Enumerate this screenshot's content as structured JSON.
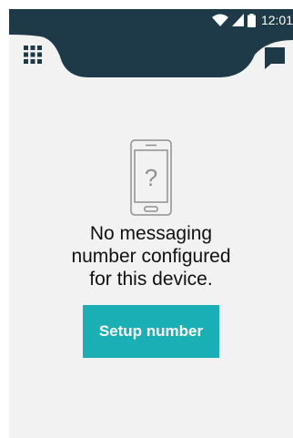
{
  "status_bar": {
    "time": "12:01",
    "icons": [
      "wifi-icon",
      "cellular-signal-icon",
      "battery-icon"
    ]
  },
  "app_bar": {
    "left_icon": "apps-grid-icon",
    "right_icon": "chat-bubble-icon"
  },
  "empty_state": {
    "illustration": "phone-question-icon",
    "message": "No messaging number configured for this device.",
    "button_label": "Setup number"
  },
  "colors": {
    "app_bar": "#1e3a48",
    "background": "#f2f2f2",
    "accent": "#1aafb4",
    "text": "#111111"
  }
}
